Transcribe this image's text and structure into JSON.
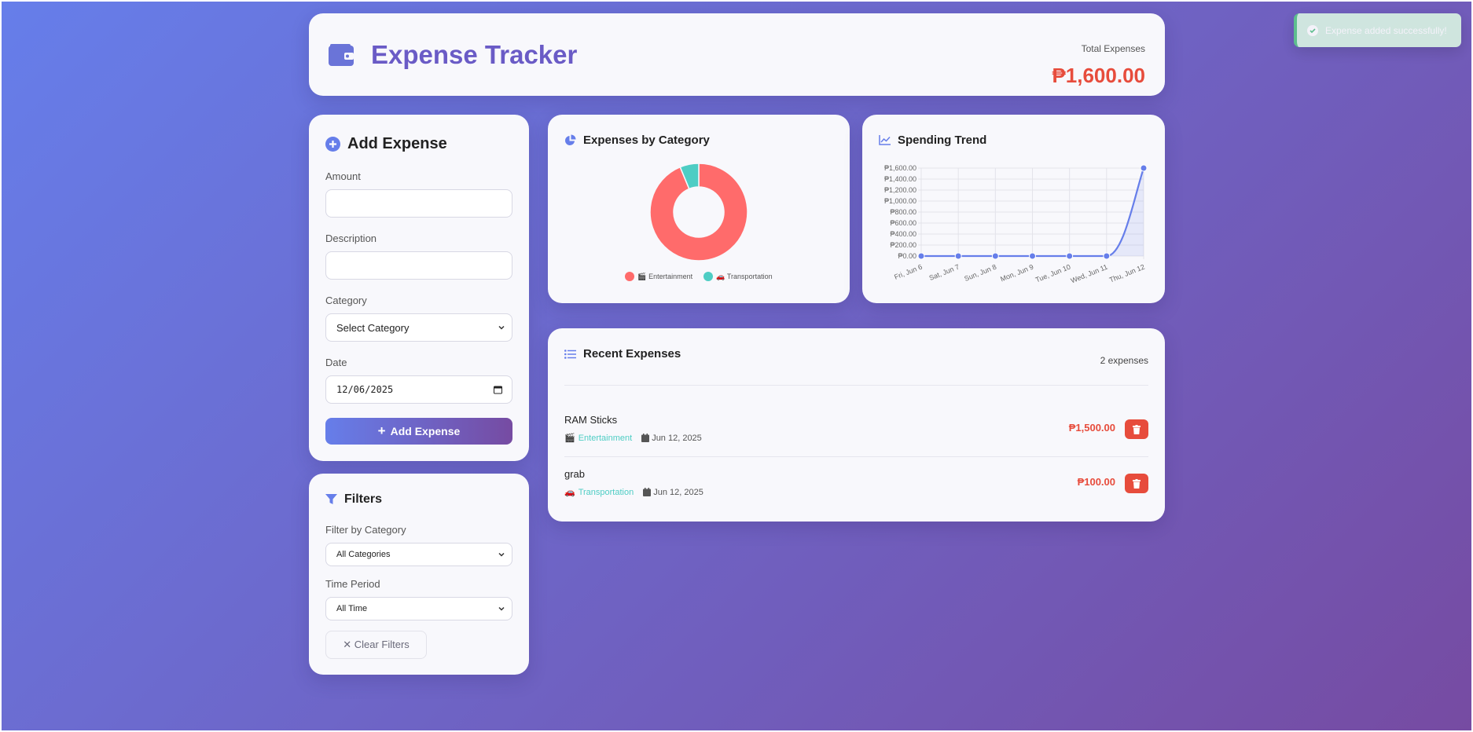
{
  "header": {
    "title": "Expense Tracker",
    "total_label": "Total Expenses",
    "total_value": "₱1,600.00"
  },
  "add_form": {
    "title": "Add Expense",
    "amount_label": "Amount",
    "amount_value": "",
    "description_label": "Description",
    "description_value": "",
    "category_label": "Category",
    "category_value": "Select Category",
    "date_label": "Date",
    "date_value": "12/06/2025",
    "submit_label": "Add Expense"
  },
  "filters": {
    "title": "Filters",
    "category_label": "Filter by Category",
    "category_value": "All Categories",
    "period_label": "Time Period",
    "period_value": "All Time",
    "clear_label": "✕ Clear Filters"
  },
  "category_chart": {
    "title": "Expenses by Category",
    "legend": [
      {
        "emoji": "🎬",
        "label": "Entertainment",
        "color": "#ff6b6b"
      },
      {
        "emoji": "🚗",
        "label": "Transportation",
        "color": "#4ecdc4"
      }
    ]
  },
  "trend_chart": {
    "title": "Spending Trend"
  },
  "chart_data": [
    {
      "type": "pie",
      "title": "Expenses by Category",
      "categories": [
        "🎬 Entertainment",
        "🚗 Transportation"
      ],
      "values": [
        1500,
        100
      ],
      "colors": [
        "#ff6b6b",
        "#4ecdc4"
      ],
      "donut": true,
      "legend": "bottom"
    },
    {
      "type": "line",
      "title": "Spending Trend",
      "categories": [
        "Fri, Jun 6",
        "Sat, Jun 7",
        "Sun, Jun 8",
        "Mon, Jun 9",
        "Tue, Jun 10",
        "Wed, Jun 11",
        "Thu, Jun 12"
      ],
      "values": [
        0,
        0,
        0,
        0,
        0,
        0,
        1600
      ],
      "ylim": [
        0,
        1600
      ],
      "yticks": [
        "₱0.00",
        "₱200.00",
        "₱400.00",
        "₱600.00",
        "₱800.00",
        "₱1,000.00",
        "₱1,200.00",
        "₱1,400.00",
        "₱1,600.00"
      ],
      "color": "#667eea",
      "fill": true,
      "grid": true
    }
  ],
  "recent": {
    "title": "Recent Expenses",
    "count": "2 expenses",
    "items": [
      {
        "description": "RAM Sticks",
        "emoji": "🎬",
        "category": "Entertainment",
        "category_color": "#4ecdc4",
        "date": "Jun 12, 2025",
        "amount": "₱1,500.00"
      },
      {
        "description": "grab",
        "emoji": "🚗",
        "category": "Transportation",
        "category_color": "#4ecdc4",
        "date": "Jun 12, 2025",
        "amount": "₱100.00"
      }
    ]
  },
  "toast": {
    "message": "Expense added successfully!"
  }
}
